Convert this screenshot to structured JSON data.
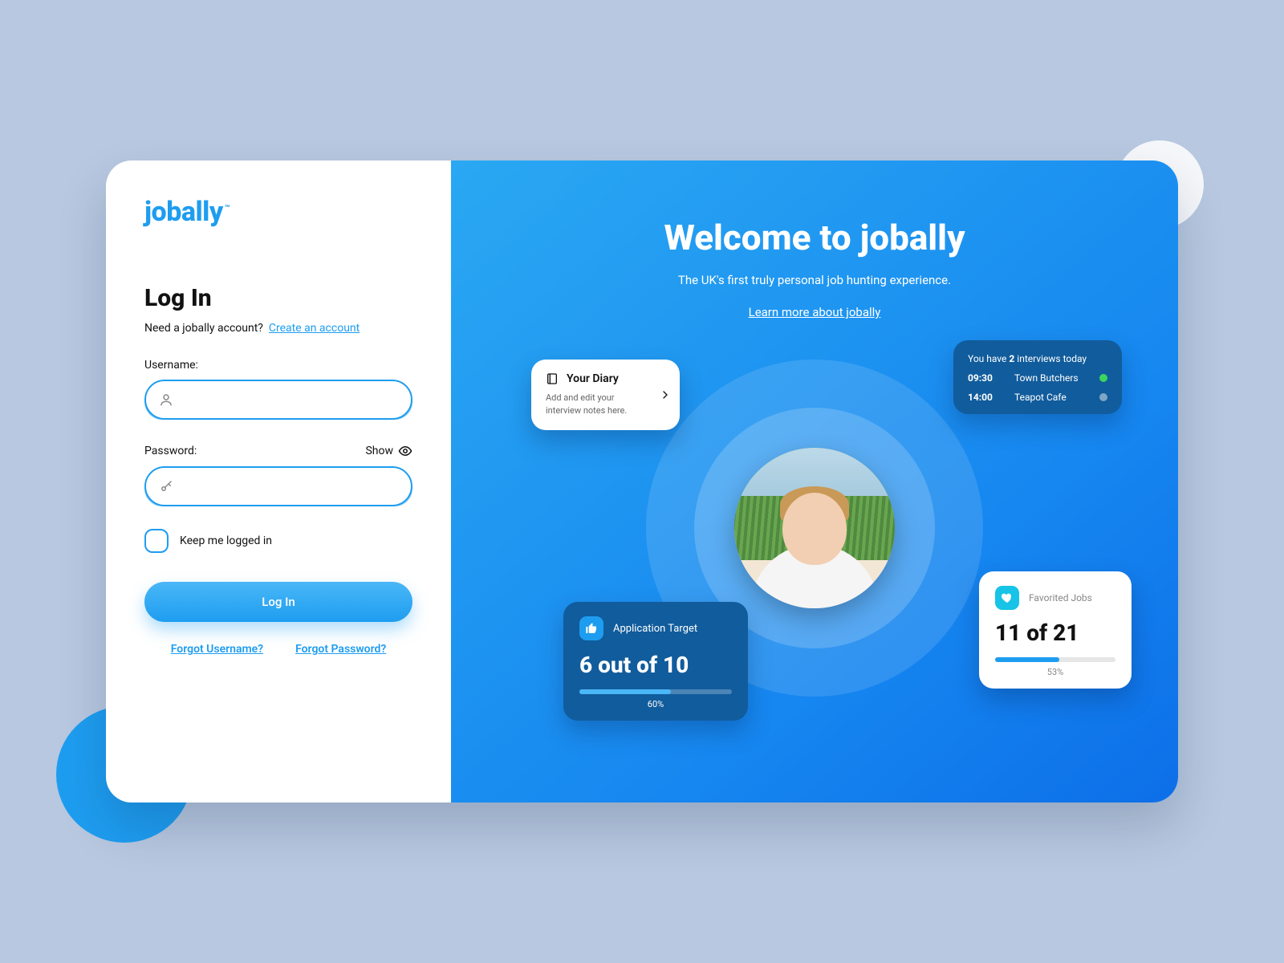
{
  "brand": {
    "name": "jobally",
    "tm": "™"
  },
  "login": {
    "heading": "Log In",
    "need_account_text": "Need a jobally account?",
    "create_account_link": "Create an account",
    "username_label": "Username:",
    "password_label": "Password:",
    "show_password": "Show",
    "keep_logged_in": "Keep me logged in",
    "submit": "Log In",
    "forgot_username": "Forgot Username?",
    "forgot_password": "Forgot Password?"
  },
  "hero": {
    "title": "Welcome to jobally",
    "subtitle": "The UK's first truly personal job hunting experience.",
    "learn_more": "Learn more about jobally"
  },
  "widgets": {
    "diary": {
      "title": "Your Diary",
      "desc": "Add and edit your interview notes here."
    },
    "interviews": {
      "prefix": "You have ",
      "count": "2",
      "suffix": " interviews today",
      "items": [
        {
          "time": "09:30",
          "place": "Town Butchers",
          "status": "green"
        },
        {
          "time": "14:00",
          "place": "Teapot Cafe",
          "status": "gray"
        }
      ]
    },
    "app_target": {
      "label": "Application Target",
      "value": "6 out of 10",
      "percent_label": "60%",
      "percent": 60
    },
    "favorited": {
      "label": "Favorited Jobs",
      "value": "11 of 21",
      "percent_label": "53%",
      "percent": 53
    }
  }
}
